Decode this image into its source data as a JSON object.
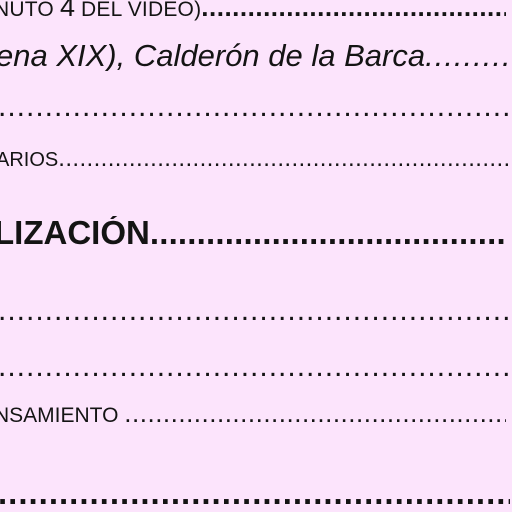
{
  "document": {
    "lines": [
      {
        "id": "line1",
        "pre": "NUTO ",
        "big": "4",
        "post": " DEL VIDEO)",
        "dots": "........................................"
      },
      {
        "id": "line2",
        "text": "ena XIX), Calderón de la Barca",
        "dots": "..................."
      },
      {
        "id": "line3",
        "dots": "........................................................................................................................"
      },
      {
        "id": "line4",
        "text": "ARIOS",
        "dots": ".............................................................................................................."
      },
      {
        "id": "line5",
        "text": "LIZACIÓN",
        "dots": "................................................................................"
      },
      {
        "id": "line6",
        "dots": "........................................................................................................................"
      },
      {
        "id": "line7",
        "dots": "........................................................................................................................"
      },
      {
        "id": "line8",
        "text": "NSAMIENTO ",
        "dots": "..............................................................................................."
      },
      {
        "id": "line9",
        "dots": "........................................................................................................................"
      }
    ]
  },
  "colors": {
    "background": "#fce4fc",
    "text": "#141414"
  }
}
